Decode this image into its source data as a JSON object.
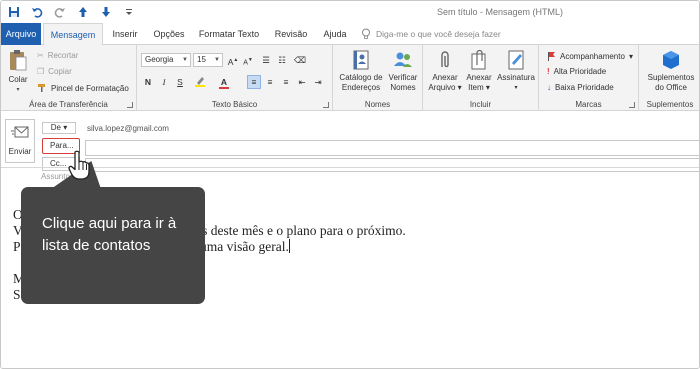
{
  "window": {
    "title": "Sem título  -  Mensagem (HTML)"
  },
  "quick_access": [
    "save-icon",
    "undo-icon",
    "redo-icon",
    "up-arrow-icon",
    "down-arrow-icon",
    "dropdown-icon"
  ],
  "tabs": [
    {
      "label": "Arquivo"
    },
    {
      "label": "Mensagem"
    },
    {
      "label": "Inserir"
    },
    {
      "label": "Opções"
    },
    {
      "label": "Formatar Texto"
    },
    {
      "label": "Revisão"
    },
    {
      "label": "Ajuda"
    }
  ],
  "tell_me": {
    "placeholder": "Diga-me o que você deseja fazer"
  },
  "ribbon": {
    "clipboard": {
      "label": "Área de Transferência",
      "paste": "Colar",
      "cut": "Recortar",
      "copy": "Copiar",
      "format_painter": "Pincel de Formatação"
    },
    "basic_text": {
      "label": "Texto Básico",
      "font": "Georgia",
      "size": "15",
      "bold": "N",
      "italic": "I",
      "underline": "S"
    },
    "names": {
      "label": "Nomes",
      "address_book": "Catálogo de Endereços",
      "check_names": "Verificar Nomes"
    },
    "include": {
      "label": "Incluir",
      "attach_file": "Anexar Arquivo",
      "attach_item": "Anexar Item",
      "signature": "Assinatura"
    },
    "tags": {
      "label": "Marcas",
      "follow_up": "Acompanhamento",
      "high_priority": "Alta Prioridade",
      "low_priority": "Baixa Prioridade"
    },
    "addins": {
      "label": "Suplementos",
      "office_addins": "Suplementos do Office"
    }
  },
  "compose": {
    "send": "Enviar",
    "from_button": "De",
    "from_email": "silva.lopez@gmail.com",
    "to_button": "Para...",
    "cc_button": "Cc...",
    "subject_label": "Assunto",
    "body_lines": [
      "O",
      "V                                  os resultados deste mês e o plano para o próximo.",
      "P                                  latório com uma visão geral.",
      "",
      "M",
      "S"
    ]
  },
  "tooltip": {
    "text": "Clique aqui para ir à lista de contatos"
  },
  "colors": {
    "accent": "#1f5fb0",
    "highlight": "#d83b3b",
    "tooltip_bg": "#454545",
    "ribbon_bg": "#f3f3f3"
  }
}
